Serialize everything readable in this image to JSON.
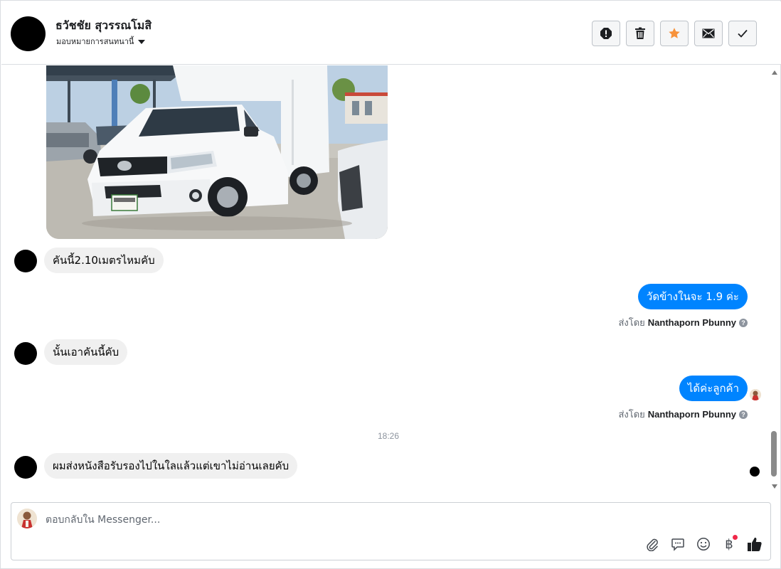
{
  "header": {
    "contact_name": "ธวัชชัย สุวรรณโมสิ",
    "assign_label": "มอบหมายการสนทนานี้",
    "actions": [
      {
        "name": "report-button",
        "icon": "exclamation-icon"
      },
      {
        "name": "delete-button",
        "icon": "trash-icon"
      },
      {
        "name": "star-button",
        "icon": "star-icon",
        "color": "#f7923b"
      },
      {
        "name": "mark-unread-button",
        "icon": "envelope-icon"
      },
      {
        "name": "mark-done-button",
        "icon": "check-icon"
      }
    ]
  },
  "thread": {
    "messages": [
      {
        "dir": "in",
        "text": "คันนี้2.10เมตรไหมคับ"
      },
      {
        "dir": "out",
        "text": "วัดข้างในจะ 1.9 ค่ะ",
        "sent_by_prefix": "ส่งโดย",
        "sent_by": "Nanthaporn Pbunny"
      },
      {
        "dir": "in",
        "text": "นั้นเอาคันนี้คับ"
      },
      {
        "dir": "out",
        "text": "ได้ค่ะลูกค้า",
        "sent_by_prefix": "ส่งโดย",
        "sent_by": "Nanthaporn Pbunny"
      },
      {
        "dir": "in",
        "text": "ผมส่งหนังสือรับรองไปในใลแล้วแต่เขาไม่อ่านเลยคับ"
      }
    ],
    "time_separator": "18:26"
  },
  "composer": {
    "placeholder": "ตอบกลับใน Messenger...",
    "tools": [
      "paperclip-icon",
      "comment-icon",
      "smiley-icon",
      "baht-icon",
      "thumbs-up-icon"
    ],
    "baht_symbol": "฿"
  },
  "colors": {
    "outgoing_bubble": "#0084ff",
    "incoming_bubble": "#f0f0f0",
    "accent_star": "#f7923b"
  }
}
